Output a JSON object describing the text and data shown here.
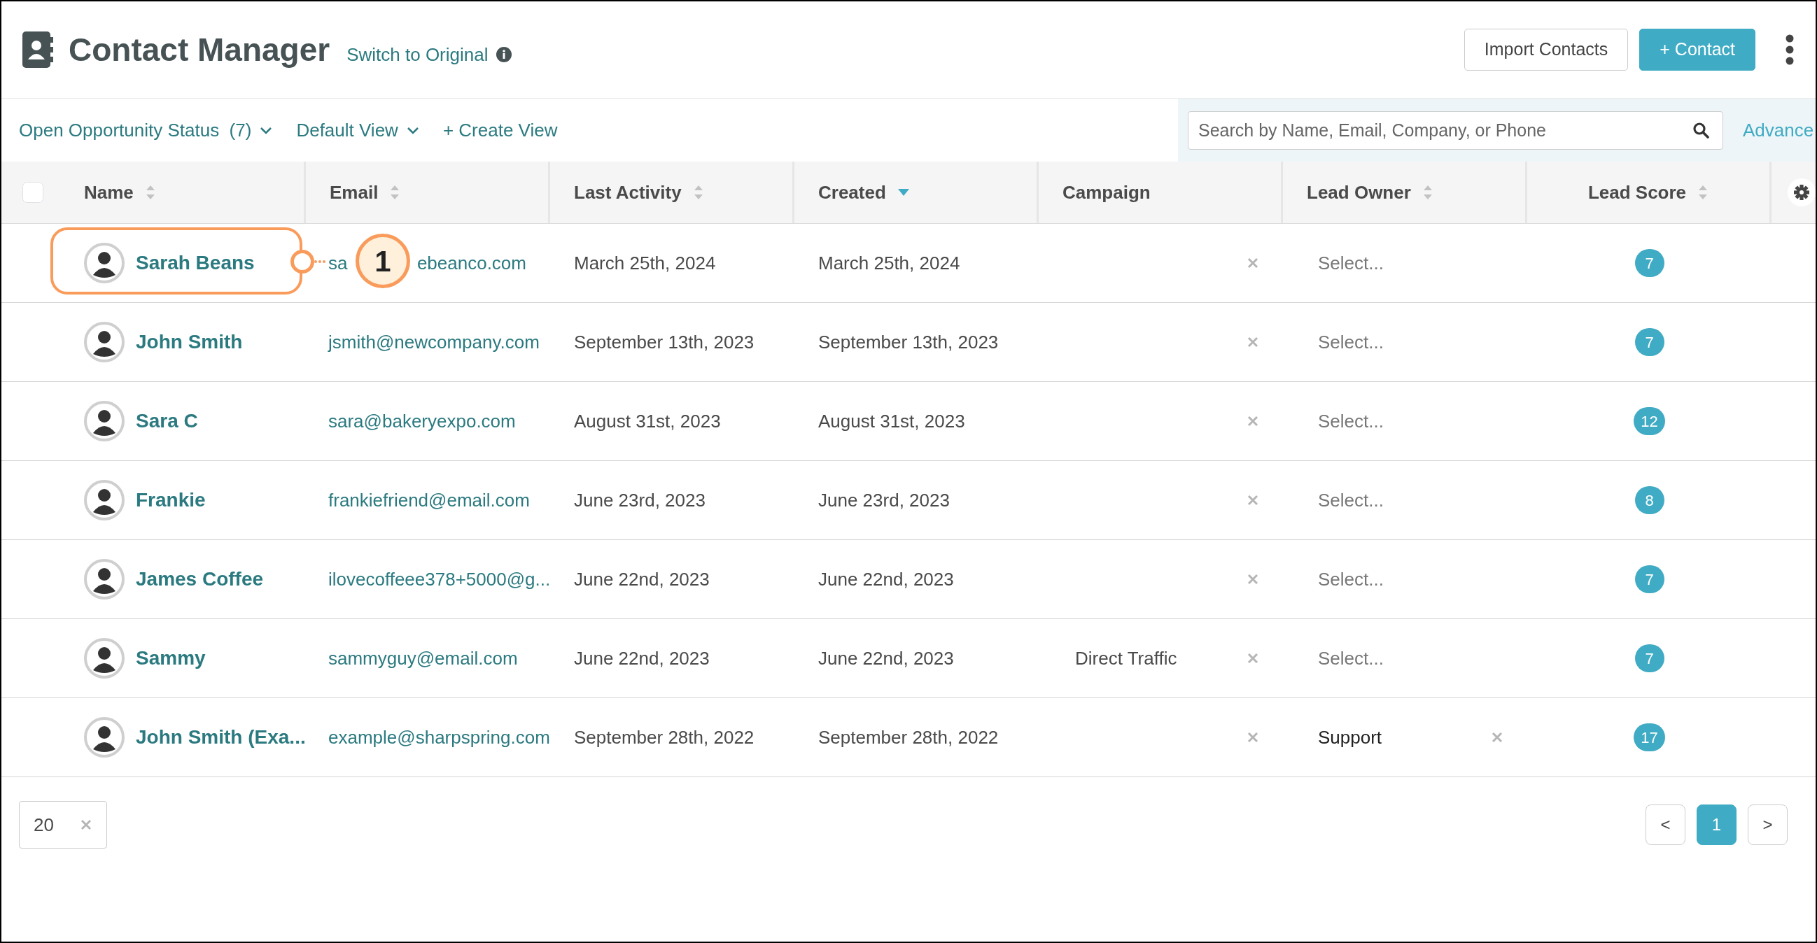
{
  "header": {
    "title": "Contact Manager",
    "switch_link": "Switch to Original",
    "buttons": [
      {
        "label": "Import Contacts",
        "kind": "outline"
      },
      {
        "label": "+ Contact",
        "kind": "primary"
      }
    ]
  },
  "toolbar": {
    "filters": [
      {
        "label": "Open Opportunity Status  (7)",
        "dropdown": true
      },
      {
        "label": "Default View",
        "dropdown": true
      },
      {
        "label": "+ Create View",
        "dropdown": false
      }
    ],
    "search": {
      "placeholder": "Search by Name, Email, Company, or Phone"
    },
    "advanced_link": "Advance"
  },
  "table": {
    "select_all": {
      "checked": false
    },
    "columns": [
      {
        "label": "Name",
        "sortable": true
      },
      {
        "label": "Email",
        "sortable": true
      },
      {
        "label": "Last Activity",
        "sortable": true
      },
      {
        "label": "Created",
        "sortable": true,
        "sorted_descending": true
      },
      {
        "label": "Campaign",
        "sortable": false
      },
      {
        "label": "Lead Owner",
        "sortable": true
      },
      {
        "label": "Lead Score",
        "sortable": true
      }
    ],
    "rows": [
      {
        "name": "Sarah Beans",
        "email_parts": [
          "sa",
          "ebeanco.com"
        ],
        "last_activity": "March 25th, 2024",
        "created": "March 25th, 2024",
        "lead_owner": "Select...",
        "owner_set": false,
        "lead_score": "7",
        "callout": "1"
      },
      {
        "name": "John Smith",
        "email_parts": [
          "jsmith@newcompany.com"
        ],
        "last_activity": "September 13th, 2023",
        "created": "September 13th, 2023",
        "lead_owner": "Select...",
        "owner_set": false,
        "lead_score": "7"
      },
      {
        "name": "Sara C",
        "email_parts": [
          "sara@bakeryexpo.com"
        ],
        "last_activity": "August 31st, 2023",
        "created": "August 31st, 2023",
        "lead_owner": "Select...",
        "owner_set": false,
        "lead_score": "12"
      },
      {
        "name": "Frankie",
        "email_parts": [
          "frankiefriend@email.com"
        ],
        "last_activity": "June 23rd, 2023",
        "created": "June 23rd, 2023",
        "lead_owner": "Select...",
        "owner_set": false,
        "lead_score": "8"
      },
      {
        "name": "James Coffee",
        "email_parts": [
          "ilovecoffeee378+5000@g..."
        ],
        "last_activity": "June 22nd, 2023",
        "created": "June 22nd, 2023",
        "lead_owner": "Select...",
        "owner_set": false,
        "lead_score": "7"
      },
      {
        "name": "Sammy",
        "email_parts": [
          "sammyguy@email.com"
        ],
        "last_activity": "June 22nd, 2023",
        "created": "June 22nd, 2023",
        "campaign": "Direct Traffic",
        "lead_owner": "Select...",
        "owner_set": false,
        "lead_score": "7"
      },
      {
        "name": "John Smith (Exa...",
        "email_parts": [
          "example@sharpspring.com"
        ],
        "last_activity": "September 28th, 2022",
        "created": "September 28th, 2022",
        "lead_owner": "Support",
        "owner_set": true,
        "lead_score": "17"
      }
    ]
  },
  "footer": {
    "page_size": "20",
    "pages": [
      {
        "label": "<",
        "selected": false
      },
      {
        "label": "1",
        "selected": true
      },
      {
        "label": ">",
        "selected": false
      }
    ]
  }
}
